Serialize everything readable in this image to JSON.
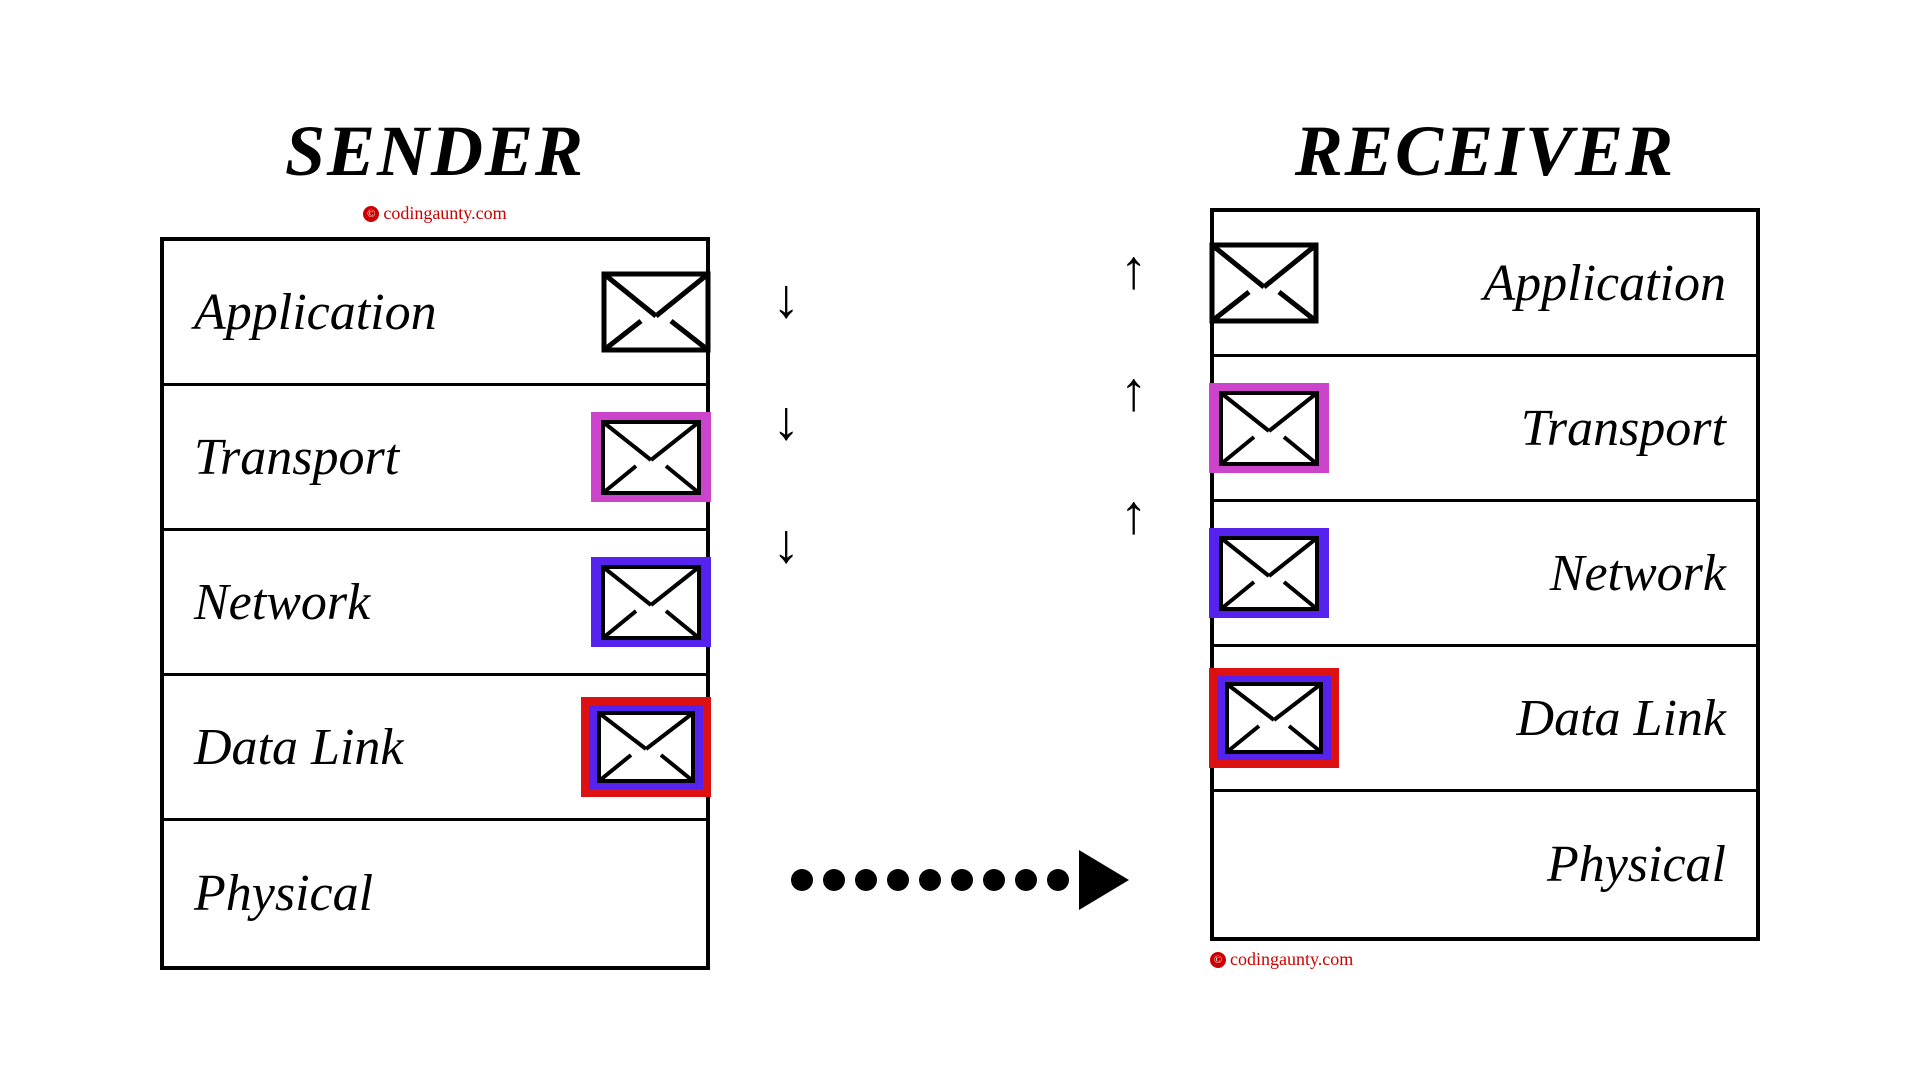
{
  "sender": {
    "title": "SENDER",
    "watermark": "codingaunty.com",
    "layers": [
      {
        "id": "application",
        "label": "Application",
        "envelope_type": "plain"
      },
      {
        "id": "transport",
        "label": "Transport",
        "envelope_type": "purple"
      },
      {
        "id": "network",
        "label": "Network",
        "envelope_type": "blue"
      },
      {
        "id": "data_link",
        "label": "Data Link",
        "envelope_type": "red"
      },
      {
        "id": "physical",
        "label": "Physical",
        "envelope_type": "none"
      }
    ]
  },
  "receiver": {
    "title": "RECEIVER",
    "watermark": "codingaunty.com",
    "layers": [
      {
        "id": "application",
        "label": "Application",
        "envelope_type": "plain"
      },
      {
        "id": "transport",
        "label": "Transport",
        "envelope_type": "purple"
      },
      {
        "id": "network",
        "label": "Network",
        "envelope_type": "blue"
      },
      {
        "id": "data_link",
        "label": "Data Link",
        "envelope_type": "red"
      },
      {
        "id": "physical",
        "label": "Physical",
        "envelope_type": "none"
      }
    ]
  },
  "arrows": {
    "down": "↓",
    "up": "↑"
  },
  "colors": {
    "background": "#ffffff",
    "text": "#000000",
    "envelope_border": "#000000",
    "transport_color": "#cc44cc",
    "network_color": "#5522ee",
    "datalink_outer": "#dd1111",
    "datalink_inner": "#5522ee",
    "watermark_color": "#cc0000"
  }
}
